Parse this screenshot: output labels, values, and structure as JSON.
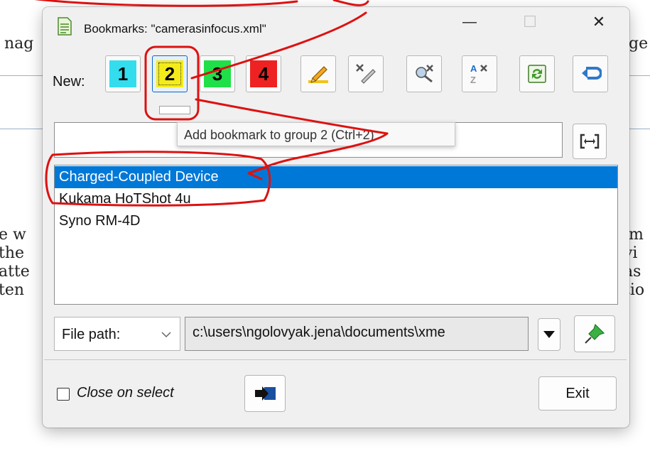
{
  "background": {
    "fragments": [
      "nag",
      "lge",
      "e w",
      "im",
      "the",
      "vi",
      "atte",
      "as",
      "ten",
      "tio"
    ]
  },
  "dialog": {
    "title": "Bookmarks: \"camerasinfocus.xml\"",
    "icon": "document-icon",
    "window_controls": {
      "minimize": "—",
      "maximize": "☐",
      "close": "✕"
    },
    "toolbar": {
      "new_label": "New:",
      "groups": [
        {
          "label": "1",
          "color": "#33ddee"
        },
        {
          "label": "2",
          "color": "#f4ec1a"
        },
        {
          "label": "3",
          "color": "#1fe048"
        },
        {
          "label": "4",
          "color": "#ee2222"
        }
      ],
      "tools": [
        "edit-pencil-icon",
        "delete-edit-icon",
        "delete-tools-icon",
        "sort-az-icon",
        "refresh-icon",
        "back-arrow-icon"
      ]
    },
    "tooltip": "Add  bookmark to group 2 (Ctrl+2)",
    "search": {
      "value": "",
      "placeholder": ""
    },
    "expand_icon": "expand-brackets-icon",
    "bookmarks": [
      {
        "name": "Charged-Coupled Device",
        "selected": true
      },
      {
        "name": "Kukama HoTShot 4u",
        "selected": false
      },
      {
        "name": "Syno RM-4D",
        "selected": false
      }
    ],
    "file_path": {
      "selector_label": "File path:",
      "value": "c:\\users\\ngolovyak.jena\\documents\\xme",
      "pin_icon": "pin-icon"
    },
    "footer": {
      "close_on_select_label": "Close on select",
      "close_on_select_checked": false,
      "exit_label": "Exit"
    }
  }
}
